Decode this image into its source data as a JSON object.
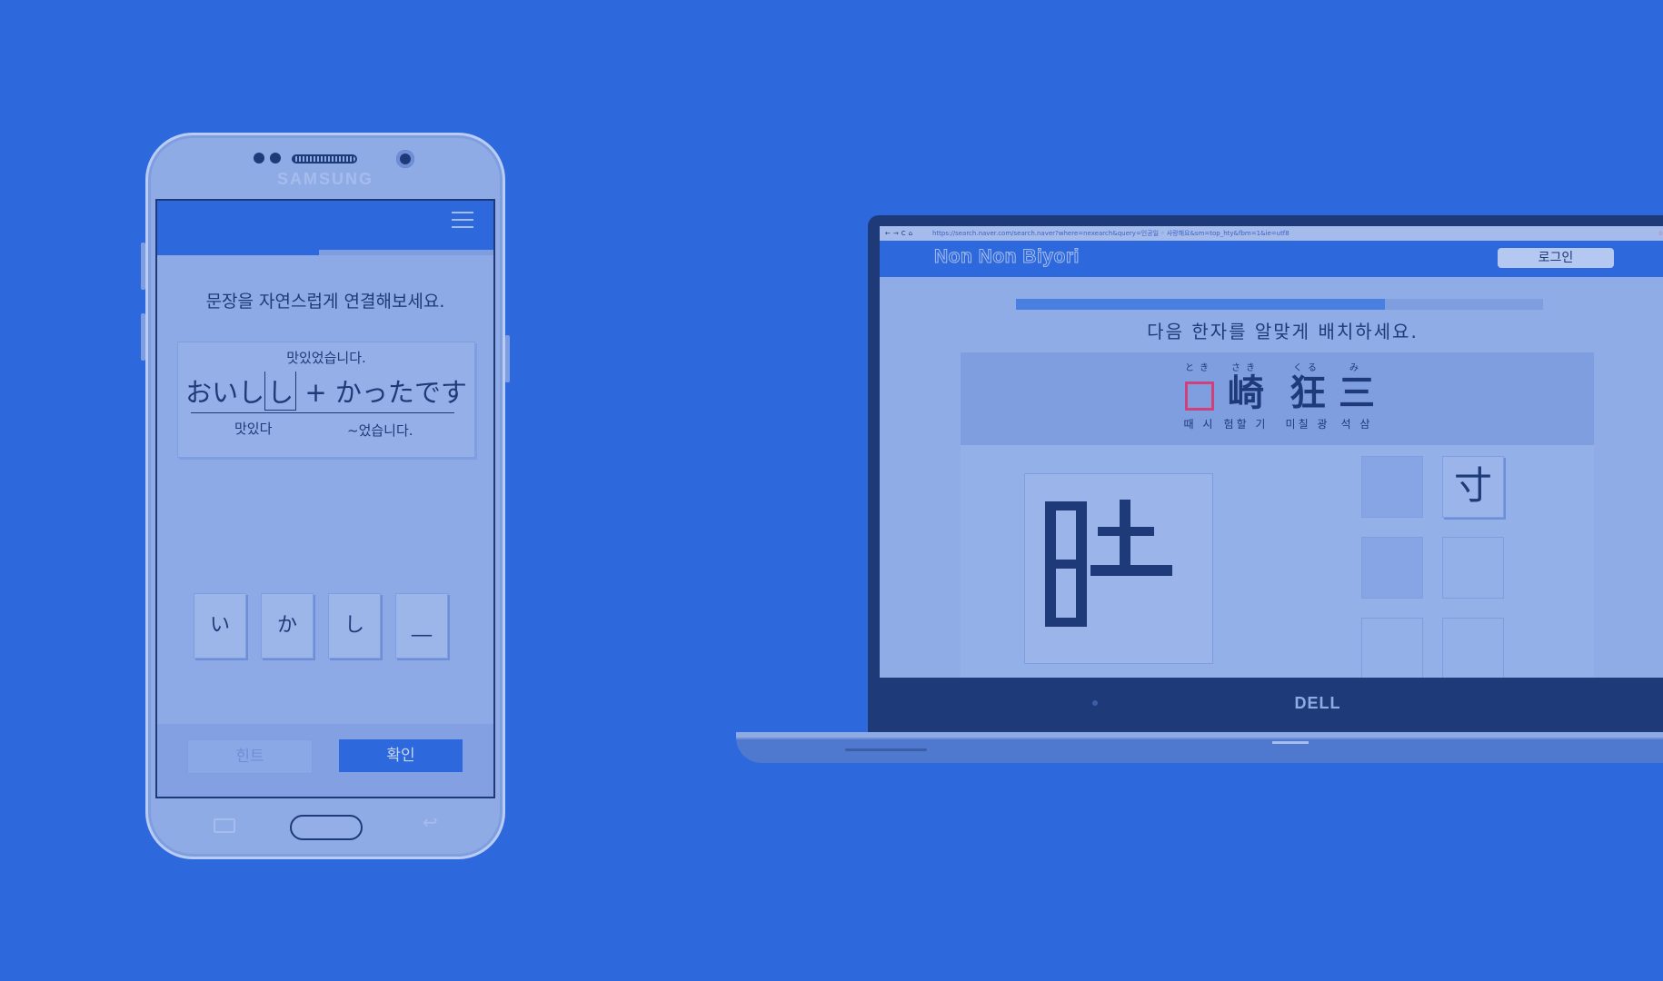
{
  "phone": {
    "brand": "SAMSUNG",
    "app": {
      "progress_fraction": 0.48,
      "menu_icon": "hamburger-icon",
      "instruction": "문장을 자연스럽게 연결해보세요.",
      "card": {
        "gloss_top": "맛있었습니다.",
        "jp_prefix": "おいし",
        "jp_slot": "し",
        "jp_suffix": " + かったです",
        "gloss_left": "맛있다",
        "gloss_right": "~었습니다."
      },
      "tiles": [
        "い",
        "か",
        "し",
        "__"
      ],
      "hint_label": "힌트",
      "confirm_label": "확인"
    }
  },
  "laptop": {
    "bezel_brand": "DELL",
    "browser": {
      "nav_icons": "←→C⌂",
      "url": "https://search.naver.com/search.naver?where=nexearch&query=인공일 ◦ 사랑해요&sm=top_hty&fbm=1&ie=utf8",
      "tools": "☆ ◎ ≡"
    },
    "site": {
      "logo": "Non Non Biyori",
      "login_label": "로그인",
      "progress_fraction": 0.7,
      "instruction": "다음 한자를 알맞게 배치하세요.",
      "words": [
        {
          "ruby": "とき",
          "kanji": "",
          "gloss": "때 시",
          "blank": true
        },
        {
          "ruby": "さき",
          "kanji": "崎",
          "gloss": "험할 기",
          "blank": false
        },
        {
          "ruby": "くる",
          "kanji": "狂",
          "gloss": "미칠 광",
          "blank": false
        },
        {
          "ruby": "み",
          "kanji": "三",
          "gloss": "석 삼",
          "blank": false
        }
      ],
      "pieces": [
        "",
        "寸",
        "",
        "",
        "",
        ""
      ]
    }
  },
  "colors": {
    "background": "#2d69dd",
    "accent": "#2d69dd",
    "dark": "#1e3a78",
    "blank_border": "#d0407a"
  }
}
